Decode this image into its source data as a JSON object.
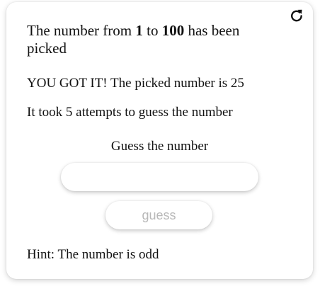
{
  "header": {
    "reset_icon": "refresh-icon",
    "headline_prefix": "The number from ",
    "range_min": "1",
    "headline_to": " to ",
    "range_max": "100",
    "headline_suffix": " has been picked"
  },
  "status": {
    "result": "YOU GOT IT! The picked number is 25",
    "attempts": "It took 5 attempts to guess the number"
  },
  "guess": {
    "label": "Guess the number",
    "input_value": "",
    "input_placeholder": "",
    "button_label": "guess"
  },
  "hint": {
    "text": "Hint: The number is odd"
  },
  "colors": {
    "text": "#111111",
    "button_text": "#b8b8b8",
    "card_background": "#ffffff"
  }
}
